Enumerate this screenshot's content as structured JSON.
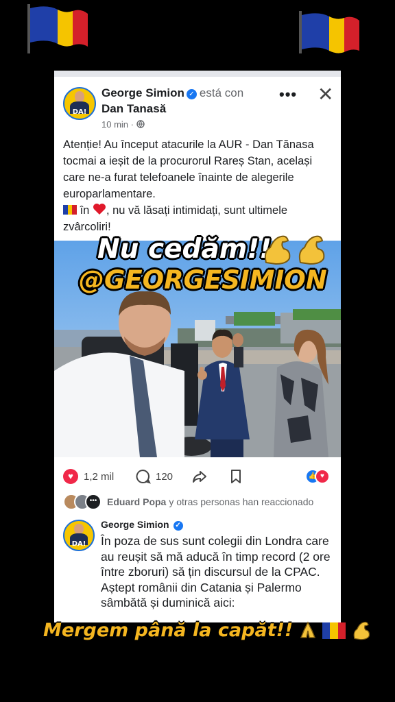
{
  "colors": {
    "accent": "#1877f2",
    "like_red": "#f02849",
    "overlay_gold": "#f5b620",
    "background": "#000000"
  },
  "post": {
    "author": "George Simion",
    "with_text": "está con",
    "tagged": "Dan Tanasă",
    "time": "10 min",
    "privacy_icon": "globe-icon",
    "text_lines": [
      "Atenție! Au început atacurile la AUR - Dan Tănasa tocmai a ieșit de la procurorul Rareș Stan, același care ne-a furat telefoanele înainte de alegerile europarlamentare.",
      "în",
      ", nu vă lăsați intimidați, sunt ultimele zvârcoliri!"
    ],
    "reactions_count": "1,2 mil",
    "comments_count": "120",
    "reacted_name": "Eduard Popa",
    "reacted_suffix": "y otras personas han reaccionado"
  },
  "avatar_badge": "DA!",
  "comment": {
    "author": "George Simion",
    "text": "În poza de sus sunt colegii din Londra care au reușit să mă aducă în timp record (2 ore între zboruri) să țin discursul de la CPAC. Aștept românii din Catania și Palermo sâmbătă și duminică aici:"
  },
  "overlay": {
    "line1": "Nu cedăm!!",
    "line2": "@GEORGESIMION",
    "bottom": "Mergem până la capăt!!"
  }
}
